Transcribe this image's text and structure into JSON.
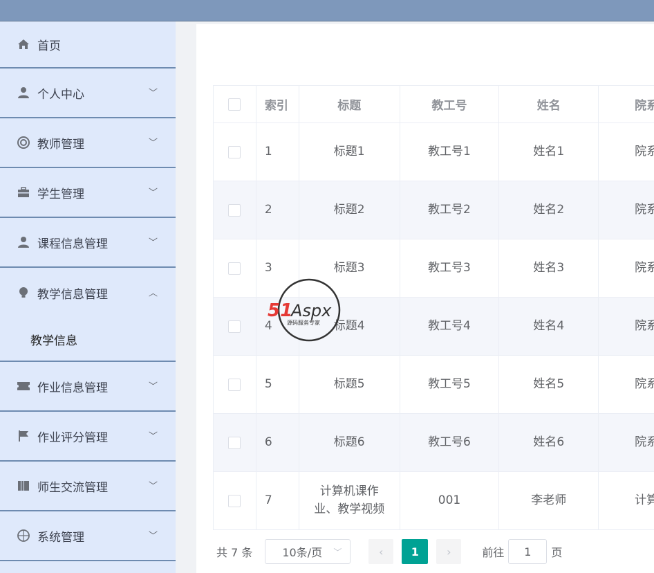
{
  "sidebar": {
    "items": [
      {
        "label": "首页",
        "icon": "home-icon"
      },
      {
        "label": "个人中心",
        "icon": "user-icon"
      },
      {
        "label": "教师管理",
        "icon": "lifebuoy-icon"
      },
      {
        "label": "学生管理",
        "icon": "briefcase-icon"
      },
      {
        "label": "课程信息管理",
        "icon": "user-icon"
      },
      {
        "label": "教学信息管理",
        "icon": "bulb-icon"
      },
      {
        "label": "作业信息管理",
        "icon": "ticket-icon"
      },
      {
        "label": "作业评分管理",
        "icon": "flag-icon"
      },
      {
        "label": "师生交流管理",
        "icon": "book-icon"
      },
      {
        "label": "系统管理",
        "icon": "compass-icon"
      }
    ],
    "submenu": {
      "label": "教学信息"
    }
  },
  "table": {
    "headers": [
      "索引",
      "标题",
      "教工号",
      "姓名",
      "院系"
    ],
    "rows": [
      {
        "index": "1",
        "title": "标题1",
        "staff_no": "教工号1",
        "name": "姓名1",
        "dept": "院系"
      },
      {
        "index": "2",
        "title": "标题2",
        "staff_no": "教工号2",
        "name": "姓名2",
        "dept": "院系"
      },
      {
        "index": "3",
        "title": "标题3",
        "staff_no": "教工号3",
        "name": "姓名3",
        "dept": "院系"
      },
      {
        "index": "4",
        "title": "标题4",
        "staff_no": "教工号4",
        "name": "姓名4",
        "dept": "院系"
      },
      {
        "index": "5",
        "title": "标题5",
        "staff_no": "教工号5",
        "name": "姓名5",
        "dept": "院系"
      },
      {
        "index": "6",
        "title": "标题6",
        "staff_no": "教工号6",
        "name": "姓名6",
        "dept": "院系"
      },
      {
        "index": "7",
        "title": "计算机课作业、教学视频",
        "staff_no": "001",
        "name": "李老师",
        "dept": "计算"
      }
    ]
  },
  "pagination": {
    "total_text": "共 7 条",
    "page_size": "10条/页",
    "current_page": "1",
    "jump_prefix": "前往",
    "jump_value": "1",
    "jump_suffix": "页"
  },
  "watermark": {
    "brand": "51Aspx",
    "tagline": "源码服务专家"
  },
  "colors": {
    "accent": "#00a294",
    "sidebar_bg": "#dfe9fb",
    "topbar": "#7e98bb"
  }
}
